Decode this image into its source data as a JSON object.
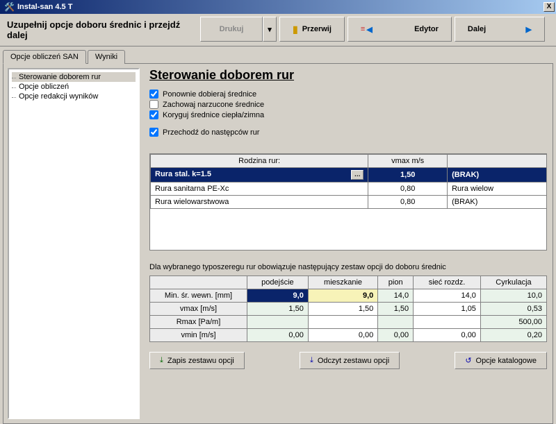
{
  "window": {
    "title": "Instal-san 4.5 T"
  },
  "toolbar": {
    "instruction": "Uzupełnij opcje doboru średnic i przejdź dalej",
    "print": "Drukuj",
    "break": "Przerwij",
    "editor": "Edytor",
    "next": "Dalej"
  },
  "tabs": {
    "tab1": "Opcje obliczeń SAN",
    "tab2": "Wyniki"
  },
  "tree": {
    "t1": "Sterowanie doborem rur",
    "t2": "Opcje obliczeń",
    "t3": "Opcje redakcji wyników"
  },
  "main": {
    "heading": "Sterowanie doborem rur",
    "chk1": "Ponownie dobieraj średnice",
    "chk2": "Zachowaj narzucone średnice",
    "chk3": "Koryguj średnice ciepła/zimna",
    "chk4": "Przechodź do następców rur"
  },
  "pipes": {
    "col_family": "Rodzina rur:",
    "col_vmax": "vmax m/s",
    "rows": [
      {
        "name": "Rura stal. k=1.5",
        "vmax": "1,50",
        "next": "(BRAK)",
        "selected": true
      },
      {
        "name": "Rura sanitarna PE-Xc",
        "vmax": "0,80",
        "next": "Rura wielow"
      },
      {
        "name": "Rura wielowarstwowa",
        "vmax": "0,80",
        "next": "(BRAK)"
      }
    ]
  },
  "note": "Dla wybranego typoszeregu rur obowiązuje następujący zestaw opcji do doboru średnic",
  "opts": {
    "cols": [
      "podejście",
      "mieszkanie",
      "pion",
      "sieć rozdz.",
      "Cyrkulacja"
    ],
    "rows": [
      {
        "label": "Min. śr. wewn. [mm]",
        "v": [
          "9,0",
          "9,0",
          "14,0",
          "14,0",
          "10,0"
        ]
      },
      {
        "label": "vmax [m/s]",
        "v": [
          "1,50",
          "1,50",
          "1,50",
          "1,05",
          "0,53"
        ]
      },
      {
        "label": "Rmax [Pa/m]",
        "v": [
          "",
          "",
          "",
          "",
          "500,00"
        ]
      },
      {
        "label": "vmin [m/s]",
        "v": [
          "0,00",
          "0,00",
          "0,00",
          "0,00",
          "0,20"
        ]
      }
    ]
  },
  "buttons": {
    "save": "Zapis zestawu opcji",
    "load": "Odczyt zestawu opcji",
    "catalog": "Opcje katalogowe"
  }
}
